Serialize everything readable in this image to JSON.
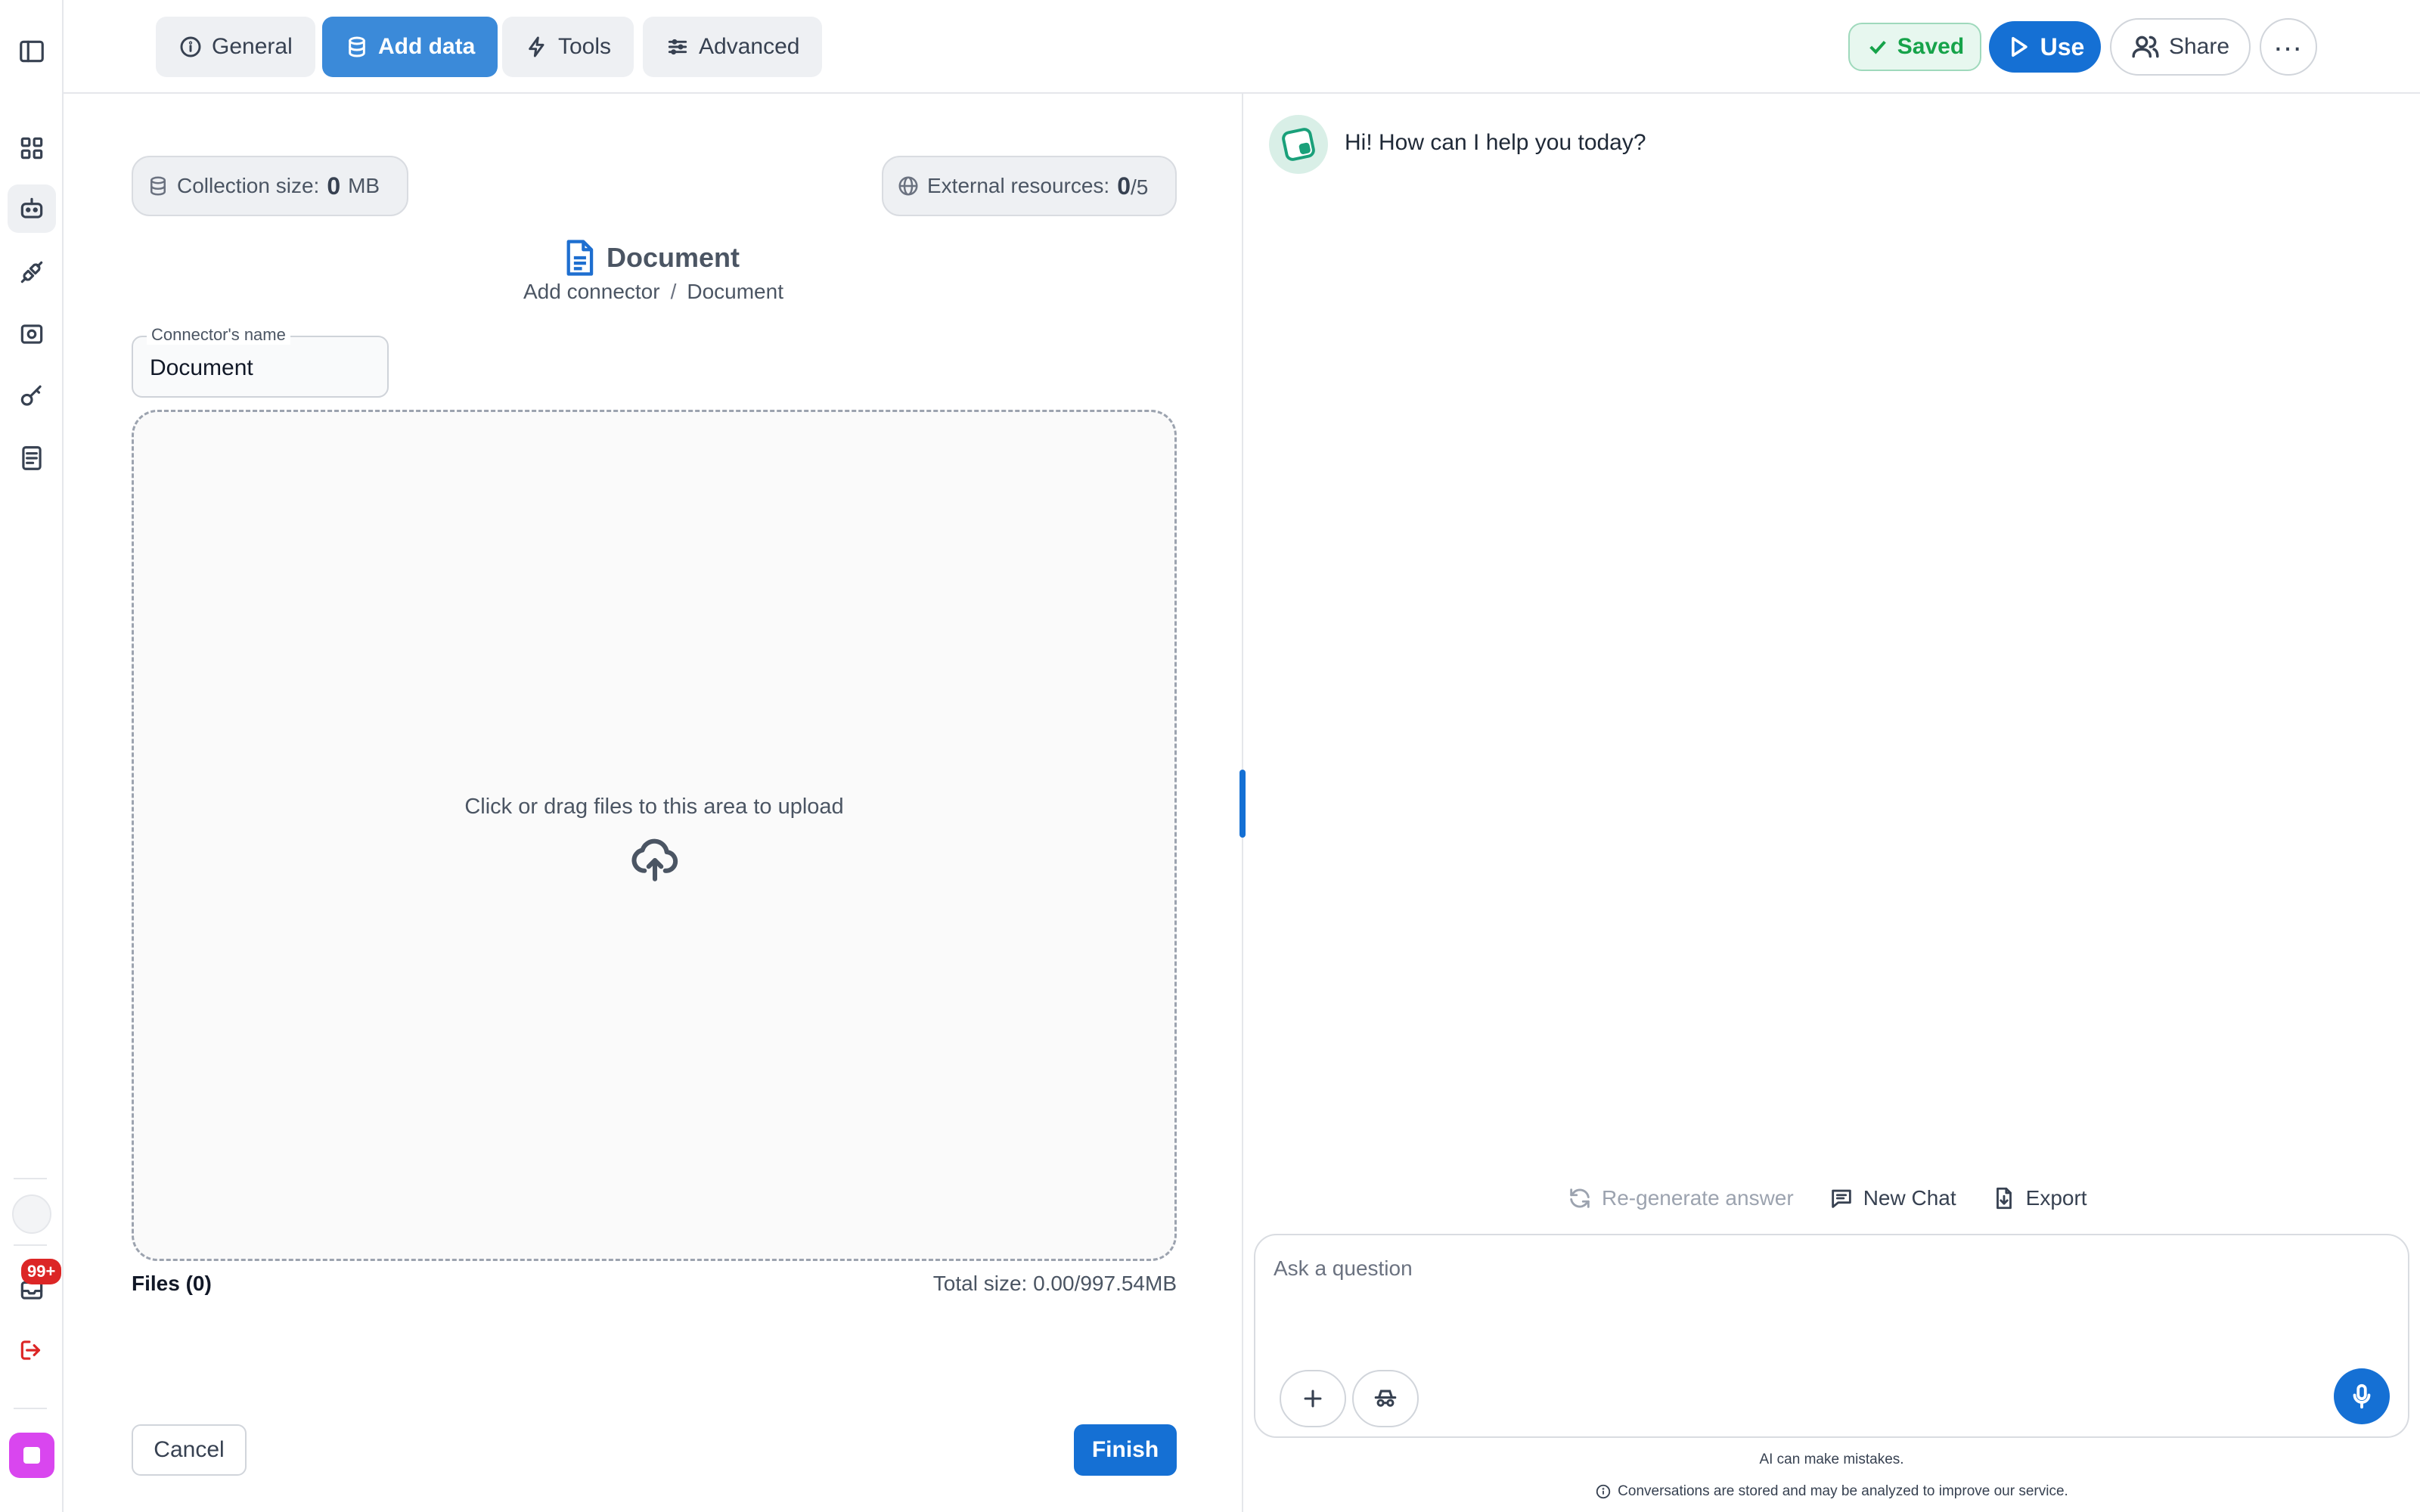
{
  "rail": {
    "badge": "99+"
  },
  "tabs": [
    {
      "label": "General",
      "icon": "info-icon"
    },
    {
      "label": "Add data",
      "icon": "database-icon",
      "active": true
    },
    {
      "label": "Tools",
      "icon": "lightning-icon"
    },
    {
      "label": "Advanced",
      "icon": "sliders-icon"
    }
  ],
  "header": {
    "saved_label": "Saved",
    "use_label": "Use",
    "share_label": "Share"
  },
  "stats": {
    "collection_label": "Collection size:",
    "collection_value": "0",
    "collection_unit": "MB",
    "external_label": "External resources:",
    "external_value": "0",
    "external_total": "/5"
  },
  "document": {
    "title": "Document",
    "breadcrumb_parent": "Add connector",
    "breadcrumb_sep": "/",
    "breadcrumb_current": "Document"
  },
  "connector_field": {
    "label": "Connector's name",
    "value": "Document"
  },
  "dropzone": {
    "text": "Click or drag files to this area to upload"
  },
  "files": {
    "label": "Files (0)",
    "total_size": "Total size: 0.00/997.54MB"
  },
  "footer": {
    "cancel_label": "Cancel",
    "finish_label": "Finish"
  },
  "chat": {
    "greeting": "Hi! How can I help you today?",
    "regenerate_label": "Re-generate answer",
    "new_chat_label": "New Chat",
    "export_label": "Export",
    "input_placeholder": "Ask a question",
    "disclaimer": "AI can make mistakes.",
    "privacy": "Conversations are stored and may be analyzed to improve our service."
  },
  "colors": {
    "accent": "#1570d4",
    "active_tab": "#3b8ad9",
    "saved_green": "#16a34a",
    "badge_red": "#dc2626"
  }
}
